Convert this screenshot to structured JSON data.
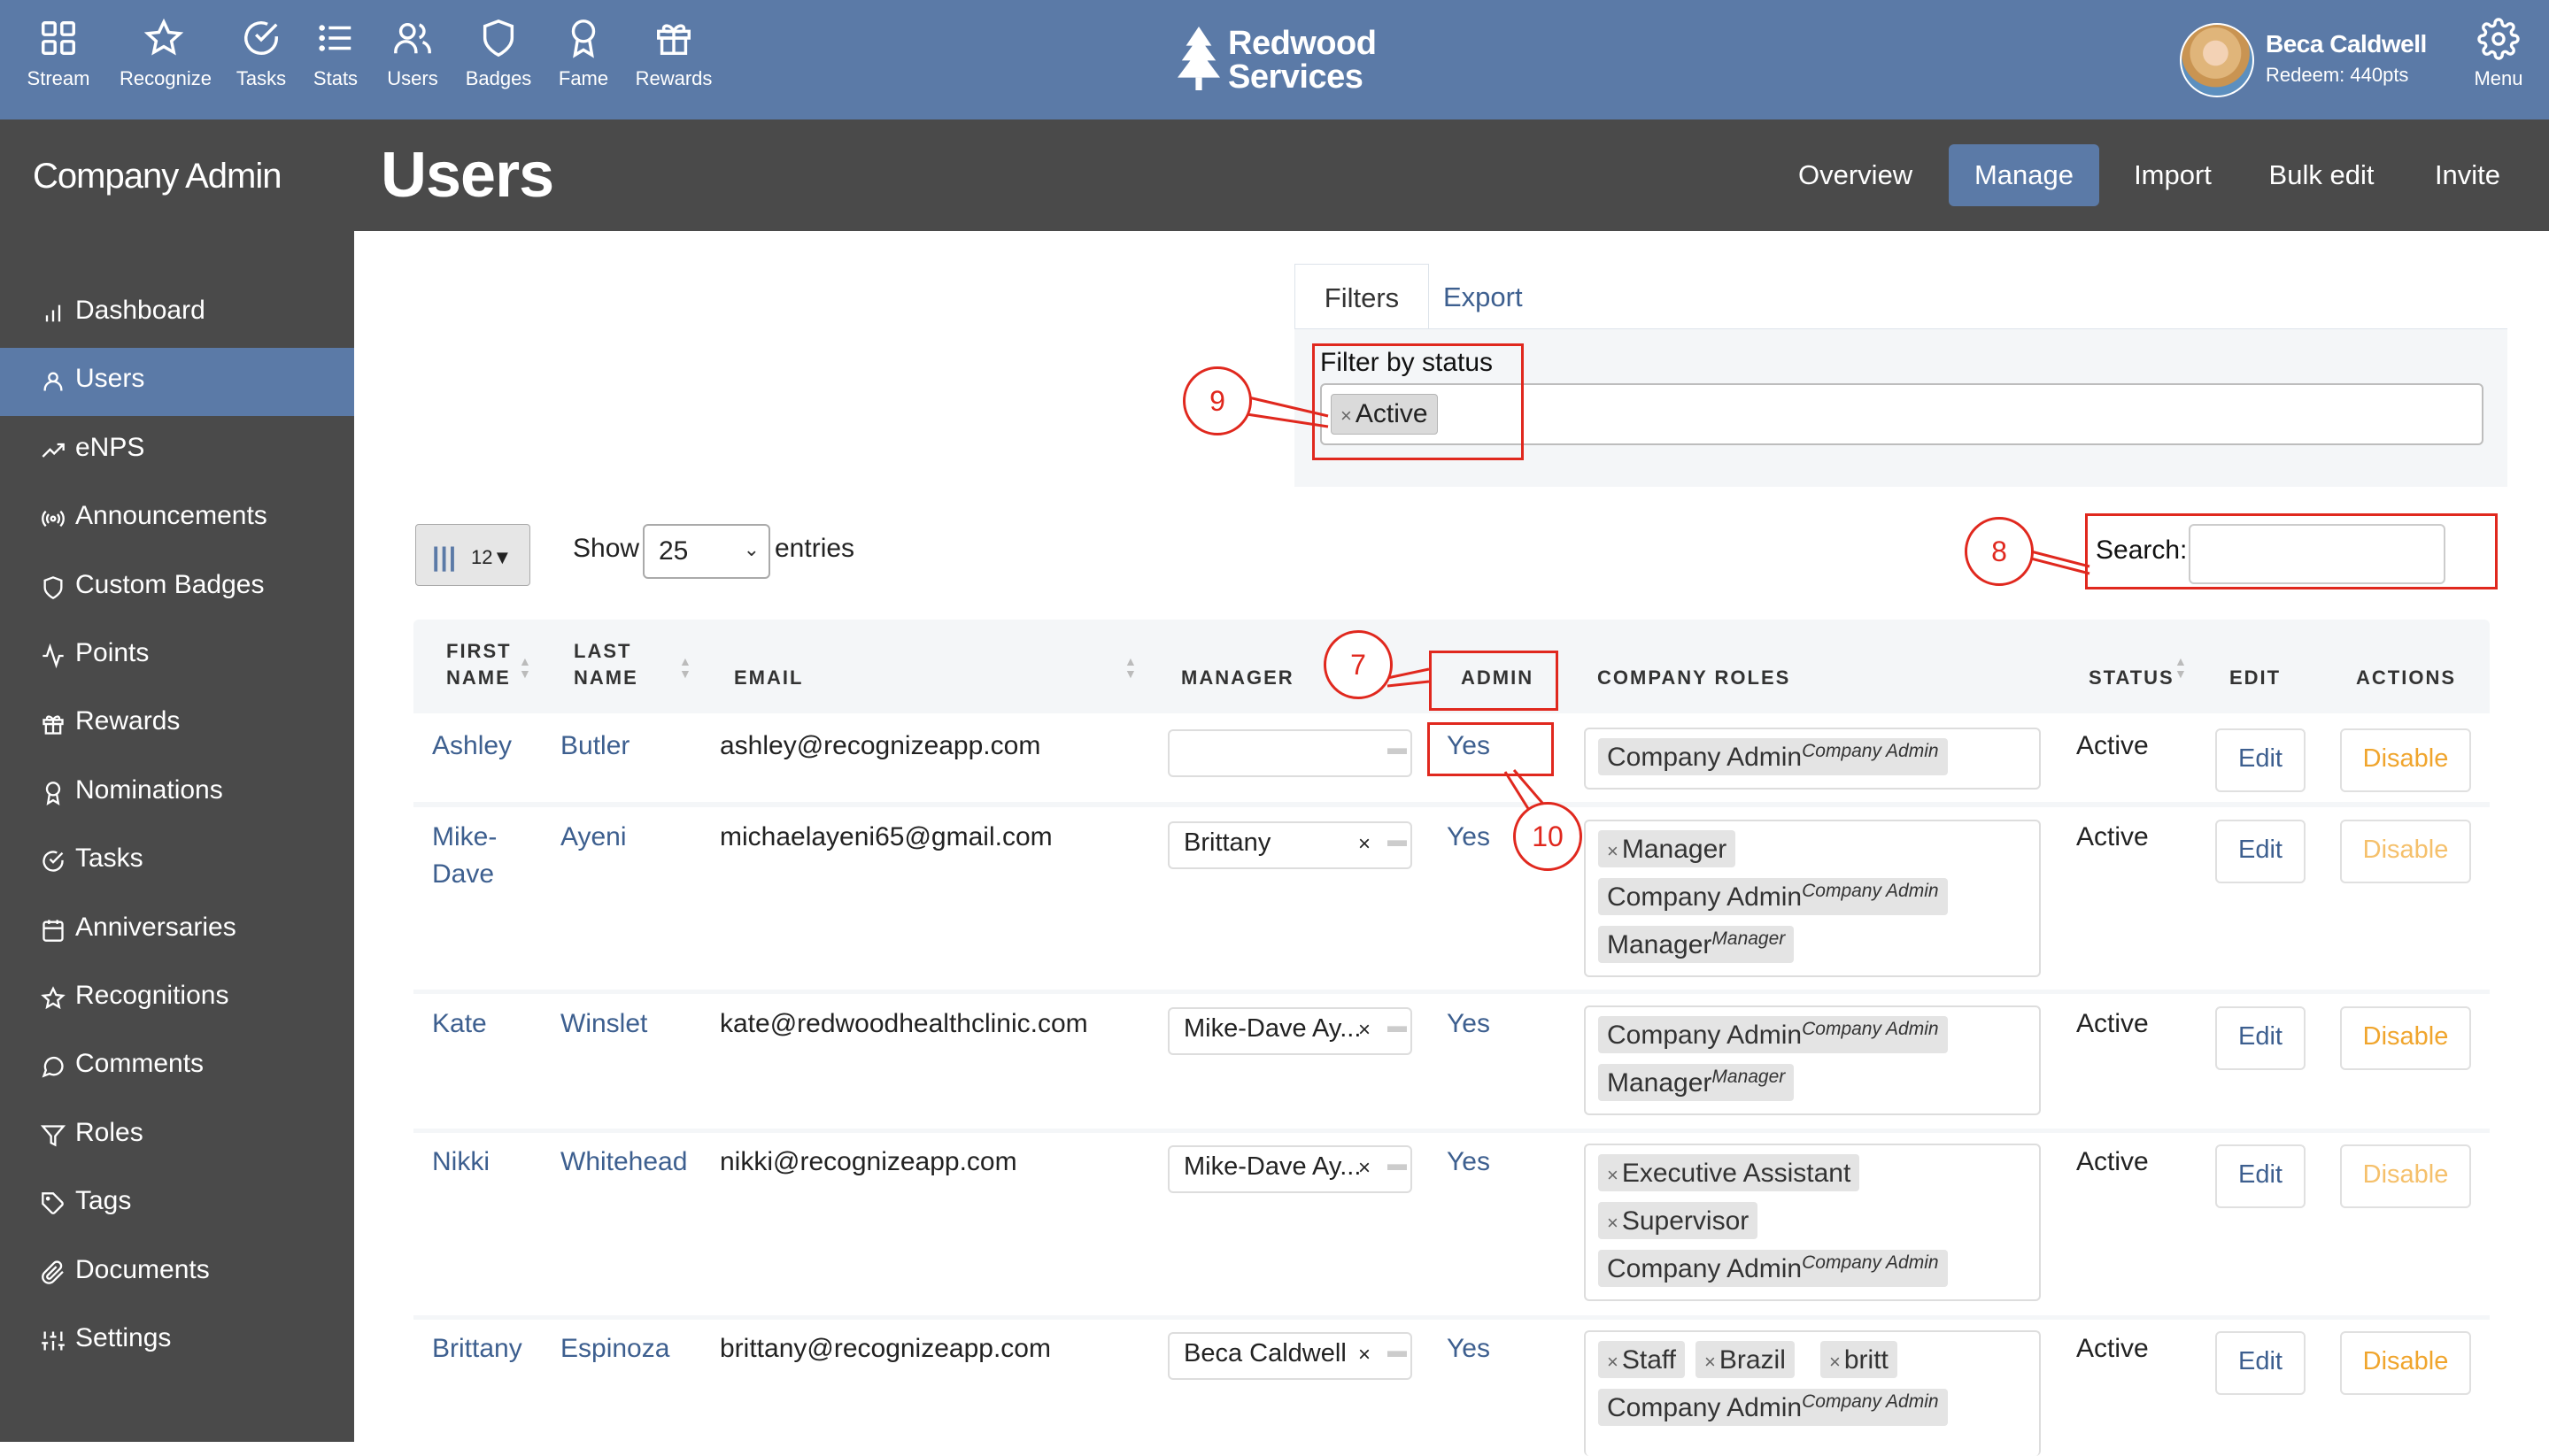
{
  "topnav": {
    "items": [
      {
        "label": "Stream",
        "icon": "grid-icon"
      },
      {
        "label": "Recognize",
        "icon": "star-icon"
      },
      {
        "label": "Tasks",
        "icon": "check-circle-icon"
      },
      {
        "label": "Stats",
        "icon": "list-icon"
      },
      {
        "label": "Users",
        "icon": "users-icon"
      },
      {
        "label": "Badges",
        "icon": "shield-icon"
      },
      {
        "label": "Fame",
        "icon": "award-icon"
      },
      {
        "label": "Rewards",
        "icon": "gift-icon"
      }
    ],
    "logo_line1": "Redwood",
    "logo_line2": "Services",
    "user_name": "Beca Caldwell",
    "user_points": "Redeem: 440pts",
    "menu_label": "Menu"
  },
  "sidebar": {
    "title": "Company Admin",
    "items": [
      {
        "label": "Dashboard",
        "icon": "bar-chart-icon"
      },
      {
        "label": "Users",
        "icon": "user-icon"
      },
      {
        "label": "eNPS",
        "icon": "trend-icon"
      },
      {
        "label": "Announcements",
        "icon": "broadcast-icon"
      },
      {
        "label": "Custom Badges",
        "icon": "shield-icon"
      },
      {
        "label": "Points",
        "icon": "activity-icon"
      },
      {
        "label": "Rewards",
        "icon": "gift-icon"
      },
      {
        "label": "Nominations",
        "icon": "award-icon"
      },
      {
        "label": "Tasks",
        "icon": "check-circle-icon"
      },
      {
        "label": "Anniversaries",
        "icon": "calendar-icon"
      },
      {
        "label": "Recognitions",
        "icon": "star-icon"
      },
      {
        "label": "Comments",
        "icon": "comment-icon"
      },
      {
        "label": "Roles",
        "icon": "filter-icon"
      },
      {
        "label": "Tags",
        "icon": "tag-icon"
      },
      {
        "label": "Documents",
        "icon": "paperclip-icon"
      },
      {
        "label": "Settings",
        "icon": "sliders-icon"
      }
    ]
  },
  "header": {
    "title": "Users",
    "tabs": [
      "Overview",
      "Manage",
      "Import",
      "Bulk edit",
      "Invite"
    ]
  },
  "filters": {
    "tabs": [
      "Filters",
      "Export"
    ],
    "status_label": "Filter by status",
    "status_chip": "Active",
    "chip_remove": "×"
  },
  "table_controls": {
    "column_count": "12▼",
    "show_label": "Show",
    "page_size": "25",
    "entries_label": "entries",
    "search_label": "Search:",
    "search_value": ""
  },
  "table": {
    "headers": {
      "first_name_1": "FIRST",
      "first_name_2": "NAME",
      "last_name_1": "LAST",
      "last_name_2": "NAME",
      "email": "EMAIL",
      "manager": "MANAGER",
      "admin": "ADMIN",
      "company_roles": "COMPANY ROLES",
      "status": "STATUS",
      "edit": "EDIT",
      "actions": "ACTIONS"
    },
    "rows": [
      {
        "first": "Ashley",
        "last": "Butler",
        "email": "ashley@recognizeapp.com",
        "manager": "",
        "admin": "Yes",
        "roles": [
          {
            "x": false,
            "name": "Company Admin",
            "sup": "Company Admin"
          }
        ],
        "status": "Active",
        "edit": "Edit",
        "action": "Disable"
      },
      {
        "first": "Mike-Dave",
        "last": "Ayeni",
        "email": "michaelayeni65@gmail.com",
        "manager": "Brittany",
        "admin": "Yes",
        "roles": [
          {
            "x": true,
            "name": "Manager",
            "sup": ""
          },
          {
            "x": false,
            "name": "Company Admin",
            "sup": "Company Admin"
          },
          {
            "x": false,
            "name": "Manager",
            "sup": "Manager"
          }
        ],
        "status": "Active",
        "edit": "Edit",
        "action": "Disable"
      },
      {
        "first": "Kate",
        "last": "Winslet",
        "email": "kate@redwoodhealthclinic.com",
        "manager": "Mike-Dave Ay...",
        "admin": "Yes",
        "roles": [
          {
            "x": false,
            "name": "Company Admin",
            "sup": "Company Admin"
          },
          {
            "x": false,
            "name": "Manager",
            "sup": "Manager"
          }
        ],
        "status": "Active",
        "edit": "Edit",
        "action": "Disable"
      },
      {
        "first": "Nikki",
        "last": "Whitehead",
        "email": "nikki@recognizeapp.com",
        "manager": "Mike-Dave Ay...",
        "admin": "Yes",
        "roles": [
          {
            "x": true,
            "name": "Executive Assistant",
            "sup": ""
          },
          {
            "x": true,
            "name": "Supervisor",
            "sup": ""
          },
          {
            "x": false,
            "name": "Company Admin",
            "sup": "Company Admin"
          }
        ],
        "status": "Active",
        "edit": "Edit",
        "action": "Disable"
      },
      {
        "first": "Brittany",
        "last": "Espinoza",
        "email": "brittany@recognizeapp.com",
        "manager": "Beca Caldwell",
        "admin": "Yes",
        "roles": [
          {
            "x": true,
            "name": "Staff",
            "sup": ""
          },
          {
            "x": true,
            "name": "Brazil",
            "sup": ""
          },
          {
            "x": true,
            "name": "britt",
            "sup": ""
          },
          {
            "x": false,
            "name": "Company Admin",
            "sup": "Company Admin"
          }
        ],
        "status": "Active",
        "edit": "Edit",
        "action": "Disable"
      }
    ]
  },
  "annotations": {
    "n7": "7",
    "n8": "8",
    "n9": "9",
    "n10": "10"
  },
  "colors": {
    "nav": "#5b7aa7",
    "sidebar": "#4a4a4a",
    "link": "#3d5f8f",
    "disable": "#f0a52d",
    "annotation": "#e0281e"
  }
}
